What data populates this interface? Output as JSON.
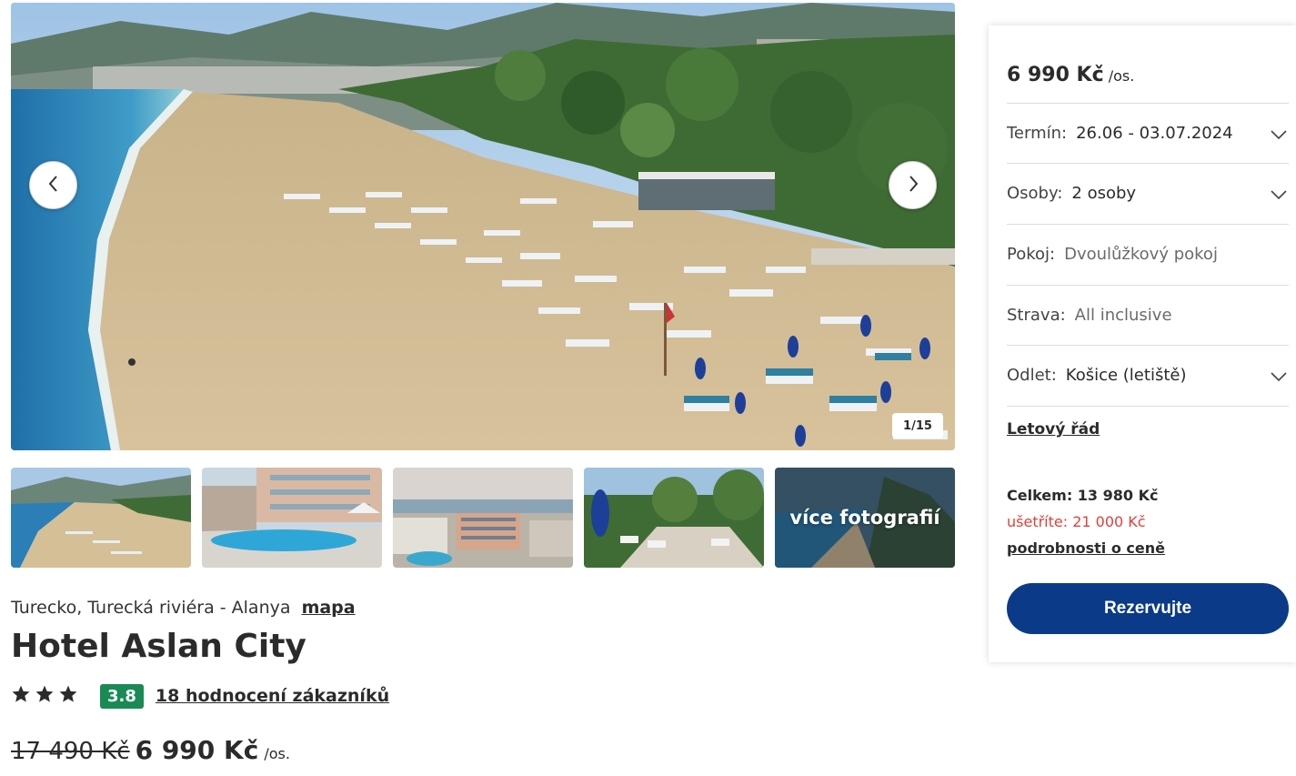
{
  "gallery": {
    "counter": "1/15",
    "more_photos_label": "více fotografií",
    "prev_icon": "chevron-left-icon",
    "next_icon": "chevron-right-icon"
  },
  "hotel": {
    "location": "Turecko, Turecká riviéra - Alanya",
    "map_link": "mapa",
    "name": "Hotel Aslan City",
    "stars": 3,
    "score": "3.8",
    "reviews_link": "18 hodnocení zákazníků",
    "old_price": "17 490 Kč",
    "price": "6 990 Kč",
    "price_unit": "/os."
  },
  "booking": {
    "price": "6 990 Kč",
    "price_unit": "/os.",
    "fields": [
      {
        "label": "Termín:",
        "value": "26.06 - 03.07.2024",
        "dropdown": true
      },
      {
        "label": "Osoby:",
        "value": "2 osoby",
        "dropdown": true
      },
      {
        "label": "Pokoj:",
        "value": "Dvoulůžkový pokoj",
        "dropdown": false
      },
      {
        "label": "Strava:",
        "value": "All inclusive",
        "dropdown": false
      },
      {
        "label": "Odlet:",
        "value": "Košice (letiště)",
        "dropdown": true
      }
    ],
    "flight_schedule_link": "Letový řád",
    "total": "Celkem: 13 980 Kč",
    "savings": "ušetříte: 21 000 Kč",
    "price_details_link": "podrobnosti o ceně",
    "reserve_button": "Rezervujte"
  },
  "colors": {
    "primary": "#0b3a88",
    "score_badge": "#1a8a55",
    "savings": "#e0403a",
    "text": "#2b2b2b"
  }
}
